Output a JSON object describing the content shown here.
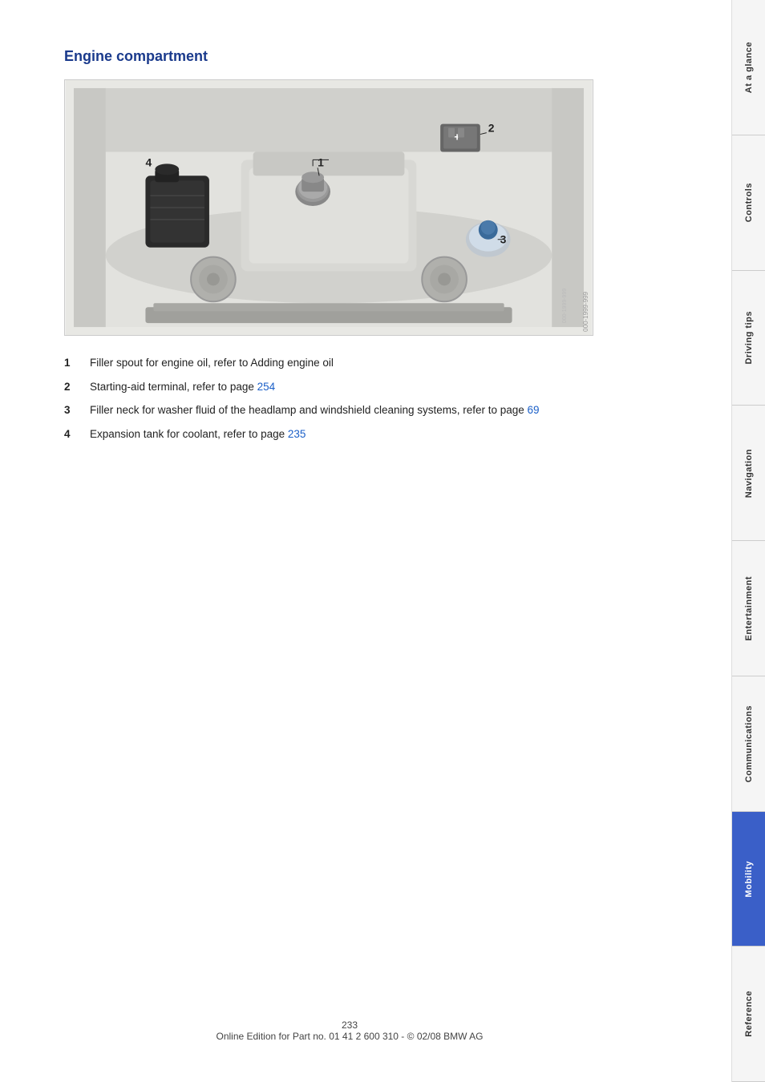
{
  "page": {
    "title": "Engine compartment",
    "page_number": "233",
    "footer_text": "Online Edition for Part no. 01 41 2 600 310 - © 02/08 BMW AG"
  },
  "items": [
    {
      "number": "1",
      "text": "Filler spout for engine oil, refer to Adding engine oil"
    },
    {
      "number": "2",
      "text": "Starting-aid terminal, refer to page ",
      "page_link": "254"
    },
    {
      "number": "3",
      "text": "Filler neck for washer fluid of the headlamp and windshield cleaning systems, refer to page ",
      "page_link": "69"
    },
    {
      "number": "4",
      "text": "Expansion tank for coolant, refer to page ",
      "page_link": "235"
    }
  ],
  "sidebar": {
    "tabs": [
      {
        "label": "At a glance",
        "active": false
      },
      {
        "label": "Controls",
        "active": false
      },
      {
        "label": "Driving tips",
        "active": false
      },
      {
        "label": "Navigation",
        "active": false
      },
      {
        "label": "Entertainment",
        "active": false
      },
      {
        "label": "Communications",
        "active": false
      },
      {
        "label": "Mobility",
        "active": true
      },
      {
        "label": "Reference",
        "active": false
      }
    ]
  }
}
